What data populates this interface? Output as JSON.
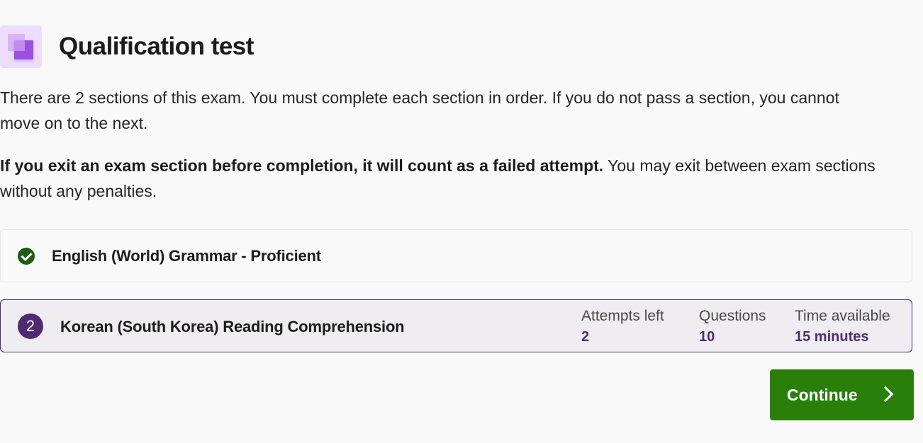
{
  "header": {
    "title": "Qualification test",
    "logo_icon": "layered-squares-icon",
    "logo_colors": [
      "#eedcfc",
      "#d6b5f8",
      "#9e4fe0"
    ]
  },
  "intro": {
    "paragraph1": "There are 2 sections of this exam. You must complete each section in order. If you do not pass a section, you cannot move on to the next.",
    "paragraph2_bold": "If you exit an exam section before completion, it will count as a failed attempt.",
    "paragraph2_rest": " You may exit between exam sections without any penalties."
  },
  "sections": [
    {
      "title": "English (World) Grammar - Proficient",
      "status": "completed",
      "status_icon": "check-circle-icon",
      "status_color": "#1f5c12"
    },
    {
      "number": "2",
      "title": "Korean (South Korea) Reading Comprehension",
      "status": "current",
      "accent_color": "#4d2a72",
      "stats": {
        "attempts_label": "Attempts left",
        "attempts_value": "2",
        "questions_label": "Questions",
        "questions_value": "10",
        "time_label": "Time available",
        "time_value": "15 minutes"
      }
    }
  ],
  "actions": {
    "continue_label": "Continue",
    "continue_icon": "chevron-right-icon",
    "continue_color": "#2a7f0a"
  }
}
